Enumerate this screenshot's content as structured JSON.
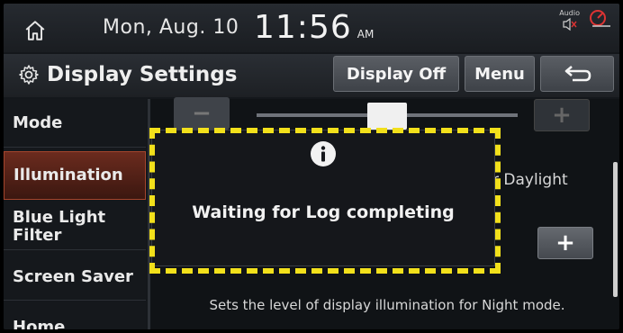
{
  "statusbar": {
    "date": "Mon, Aug. 10",
    "time": "11:56",
    "ampm": "AM",
    "audio_label": "Audio",
    "icons": [
      "home-icon",
      "audio-muted-icon",
      "uvo-icon"
    ]
  },
  "titlebar": {
    "title": "Display Settings",
    "display_off_label": "Display Off",
    "menu_label": "Menu"
  },
  "sidebar": {
    "items": [
      {
        "label": "Mode"
      },
      {
        "label": "Illumination"
      },
      {
        "label": "Blue Light Filter"
      },
      {
        "label": "Screen Saver"
      },
      {
        "label": "Home"
      }
    ],
    "active_index": 1
  },
  "content": {
    "minus_label": "−",
    "plus_label": "+",
    "mode_label": "r Daylight",
    "description": "Sets the level of display illumination for Night mode.",
    "slider_level": 0.5
  },
  "popup": {
    "message": "Waiting for Log completing",
    "icon": "info-icon"
  },
  "colors": {
    "highlight": "#f2e01b",
    "active_item": "#6b2b1e"
  }
}
